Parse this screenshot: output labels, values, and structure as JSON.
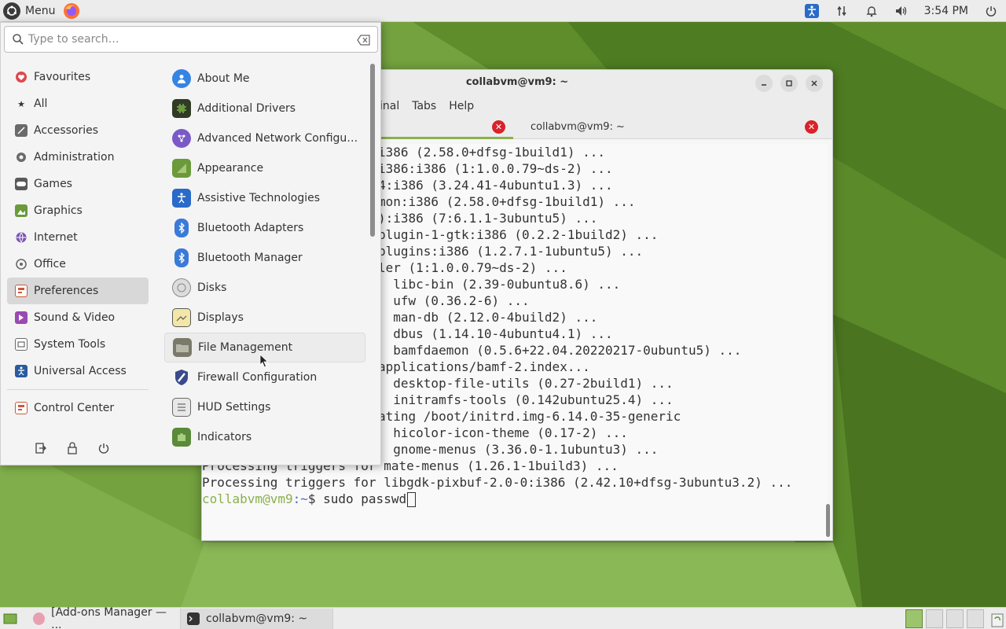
{
  "top_panel": {
    "menu_label": "Menu",
    "clock": "3:54 PM",
    "tray_icons": [
      "accessibility-icon",
      "network-icon",
      "notification-icon",
      "volume-icon",
      "power-icon"
    ]
  },
  "app_menu": {
    "search_placeholder": "Type to search…",
    "categories": [
      {
        "label": "Favourites",
        "icon": "heart-icon",
        "color": "#e0474c"
      },
      {
        "label": "All",
        "icon": "star-icon",
        "color": "#333333"
      },
      {
        "label": "Accessories",
        "icon": "accessories-icon",
        "color": "#6a6a6a"
      },
      {
        "label": "Administration",
        "icon": "administration-icon",
        "color": "#6a6a6a"
      },
      {
        "label": "Games",
        "icon": "games-icon",
        "color": "#6a6a6a"
      },
      {
        "label": "Graphics",
        "icon": "graphics-icon",
        "color": "#6a9a3a"
      },
      {
        "label": "Internet",
        "icon": "internet-icon",
        "color": "#7a55b0"
      },
      {
        "label": "Office",
        "icon": "office-icon",
        "color": "#6a6a6a"
      },
      {
        "label": "Preferences",
        "icon": "preferences-icon",
        "color": "#c85a3a"
      },
      {
        "label": "Sound & Video",
        "icon": "sound-video-icon",
        "color": "#9a4ab0"
      },
      {
        "label": "System Tools",
        "icon": "system-tools-icon",
        "color": "#6a6a6a"
      },
      {
        "label": "Universal Access",
        "icon": "universal-access-icon",
        "color": "#2a5aa0"
      }
    ],
    "control_center": "Control Center",
    "apps": [
      {
        "label": "About Me",
        "icon": "about-me-icon",
        "color": "#3584e4"
      },
      {
        "label": "Additional Drivers",
        "icon": "chip-icon",
        "color": "#4a7a2a"
      },
      {
        "label": "Advanced Network Configu…",
        "icon": "network-config-icon",
        "color": "#7a5ac8"
      },
      {
        "label": "Appearance",
        "icon": "appearance-icon",
        "color": "#6a9a3a"
      },
      {
        "label": "Assistive Technologies",
        "icon": "assistive-icon",
        "color": "#2a6ac8"
      },
      {
        "label": "Bluetooth Adapters",
        "icon": "bluetooth-icon",
        "color": "#3a7ad8"
      },
      {
        "label": "Bluetooth Manager",
        "icon": "bluetooth-icon",
        "color": "#3a7ad8"
      },
      {
        "label": "Disks",
        "icon": "disk-icon",
        "color": "#8a8a8a"
      },
      {
        "label": "Displays",
        "icon": "display-icon",
        "color": "#5a5a5a"
      },
      {
        "label": "File Management",
        "icon": "folder-icon",
        "color": "#6a6a5a"
      },
      {
        "label": "Firewall Configuration",
        "icon": "firewall-icon",
        "color": "#3a4a8a"
      },
      {
        "label": "HUD Settings",
        "icon": "hud-icon",
        "color": "#6a6a6a"
      },
      {
        "label": "Indicators",
        "icon": "puzzle-icon",
        "color": "#5a8a3a"
      }
    ]
  },
  "terminal": {
    "title": "collabvm@vm9: ~",
    "menu": [
      "inal",
      "Tabs",
      "Help"
    ],
    "tab_label": "collabvm@vm9: ~",
    "lines": [
      "i386 (2.58.0+dfsg-1build1) ...",
      "i386:i386 (1:1.0.0.79~ds-2) ...",
      "4:i386 (3.24.41-4ubuntu1.3) ...",
      "mon:i386 (2.58.0+dfsg-1build1) ...",
      "):i386 (7:6.1.1-3ubuntu5) ...",
      "plugin-1-gtk:i386 (0.2.2-1build2) ...",
      "plugins:i386 (1.2.7.1-1ubuntu5) ...",
      "ler (1:1.0.0.79~ds-2) ...",
      "  libc-bin (2.39-0ubuntu8.6) ...",
      "  ufw (0.36.2-6) ...",
      "  man-db (2.12.0-4build2) ...",
      "  dbus (1.14.10-4ubuntu4.1) ...",
      "  bamfdaemon (0.5.6+22.04.20220217-0ubuntu5) ...",
      "applications/bamf-2.index...",
      "  desktop-file-utils (0.27-2build1) ...",
      "  initramfs-tools (0.142ubuntu25.4) ...",
      "ating /boot/initrd.img-6.14.0-35-generic",
      "  hicolor-icon-theme (0.17-2) ...",
      "  gnome-menus (3.36.0-1.1ubuntu3) ...",
      "Processing triggers for mate-menus (1.26.1-1build3) ...",
      "Processing triggers for libgdk-pixbuf-2.0-0:i386 (2.42.10+dfsg-3ubuntu3.2) ..."
    ],
    "prompt_user": "collabvm@vm9",
    "prompt_path": ":~",
    "prompt_symbol": "$ ",
    "command": "sudo passwd"
  },
  "taskbar": {
    "tasks": [
      {
        "label": "[Add-ons Manager — ...",
        "icon": "firefox-icon"
      },
      {
        "label": "collabvm@vm9: ~",
        "icon": "terminal-icon"
      }
    ]
  }
}
